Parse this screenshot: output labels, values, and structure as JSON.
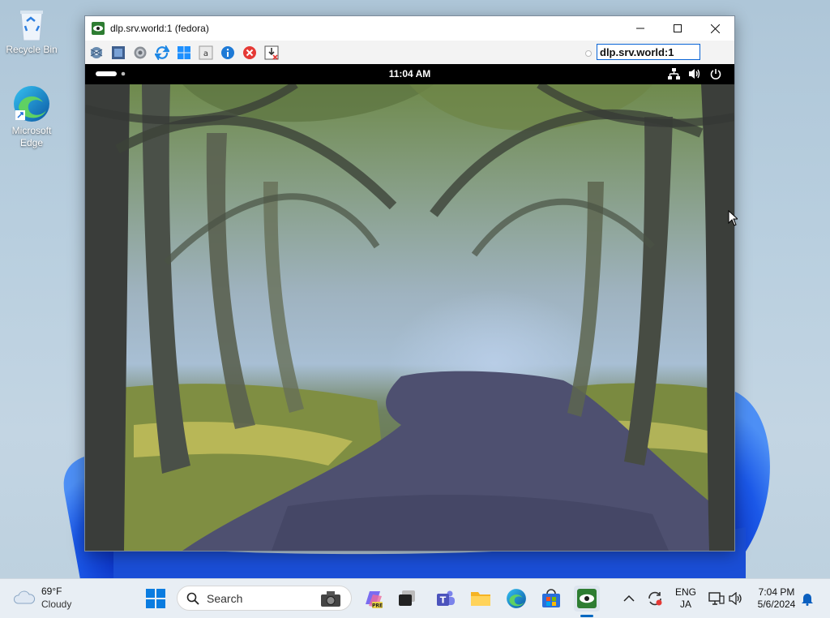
{
  "desktop": {
    "icons": [
      {
        "label": "Recycle Bin",
        "icon": "recycle-bin-icon"
      },
      {
        "label_line1": "Microsoft",
        "label_line2": "Edge",
        "icon": "edge-icon"
      }
    ]
  },
  "window": {
    "title": "dlp.srv.world:1 (fedora)",
    "hostname_value": "dlp.srv.world:1",
    "toolbar_icons": [
      "options-icon",
      "fullscreen-icon",
      "settings-icon",
      "refresh-icon",
      "windows-key-icon",
      "alt-icon",
      "info-icon",
      "disconnect-icon",
      "file-transfer-icon"
    ]
  },
  "remote": {
    "clock": "11:04 AM",
    "tray_icons": [
      "network-icon",
      "volume-icon",
      "power-icon"
    ]
  },
  "taskbar": {
    "weather": {
      "temp": "69°F",
      "condition": "Cloudy"
    },
    "search_label": "Search",
    "language_line1": "ENG",
    "language_line2": "JA",
    "time": "7:04 PM",
    "date": "5/6/2024"
  },
  "colors": {
    "accent": "#0067c0",
    "window_bg": "#ffffff",
    "taskbar_bg": "#e8eef4"
  }
}
